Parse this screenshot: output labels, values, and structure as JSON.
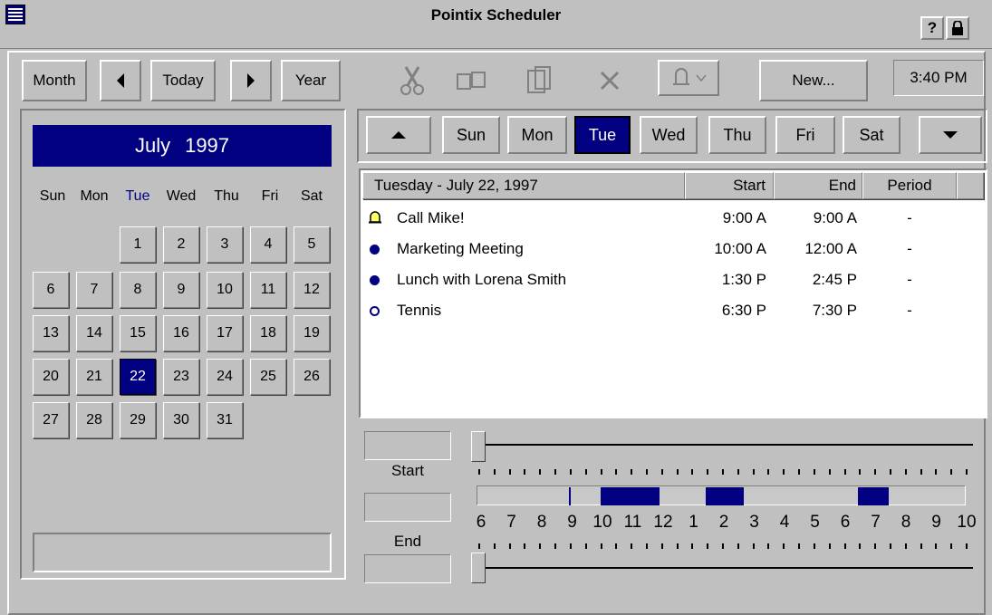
{
  "window": {
    "title": "Pointix Scheduler",
    "help_label": "?"
  },
  "nav": {
    "month": "Month",
    "today": "Today",
    "year": "Year"
  },
  "toolbar": {
    "new_label": "New...",
    "clock": "3:40 PM"
  },
  "calendar": {
    "month": "July",
    "year": "1997",
    "days_of_week": [
      "Sun",
      "Mon",
      "Tue",
      "Wed",
      "Thu",
      "Fri",
      "Sat"
    ],
    "highlighted_dow": "Tue",
    "selected_day": "22",
    "days": [
      "1",
      "2",
      "3",
      "4",
      "5",
      "6",
      "7",
      "8",
      "9",
      "10",
      "11",
      "12",
      "13",
      "14",
      "15",
      "16",
      "17",
      "18",
      "19",
      "20",
      "21",
      "22",
      "23",
      "24",
      "25",
      "26",
      "27",
      "28",
      "29",
      "30",
      "31"
    ]
  },
  "week": {
    "days": [
      "Sun",
      "Mon",
      "Tue",
      "Wed",
      "Thu",
      "Fri",
      "Sat"
    ],
    "selected": "Tue"
  },
  "appointments": {
    "headers": {
      "title": "Tuesday - July 22, 1997",
      "start": "Start",
      "end": "End",
      "period": "Period"
    },
    "rows": [
      {
        "icon": "bell-icon",
        "title": "Call Mike!",
        "start": "9:00 A",
        "end": "9:00 A",
        "period": "-"
      },
      {
        "icon": "filled-dot-icon",
        "title": "Marketing Meeting",
        "start": "10:00 A",
        "end": "12:00 A",
        "period": "-"
      },
      {
        "icon": "filled-dot-icon",
        "title": "Lunch with Lorena Smith",
        "start": "1:30 P",
        "end": "2:45 P",
        "period": "-"
      },
      {
        "icon": "open-dot-icon",
        "title": "Tennis",
        "start": "6:30 P",
        "end": "7:30 P",
        "period": "-"
      }
    ]
  },
  "timeline": {
    "start_label": "Start",
    "end_label": "End",
    "hours": [
      "6",
      "7",
      "8",
      "9",
      "10",
      "11",
      "12",
      "1",
      "2",
      "3",
      "4",
      "5",
      "6",
      "7",
      "8",
      "9",
      "10"
    ]
  },
  "colors": {
    "accent": "#000080",
    "face": "#c0c0c0"
  }
}
